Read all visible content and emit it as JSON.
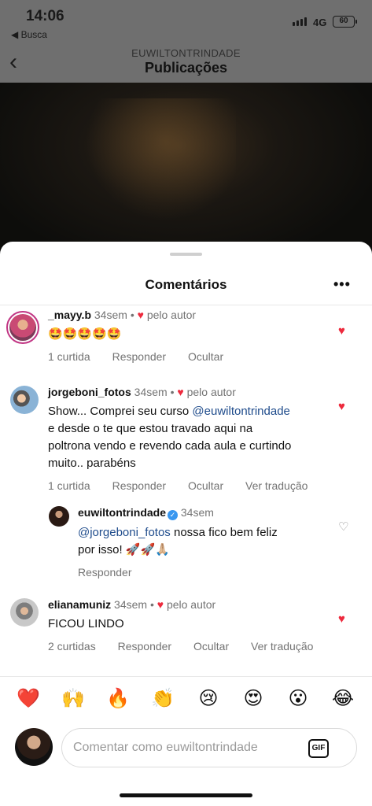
{
  "status": {
    "time": "14:06",
    "back_app": "◀ Busca",
    "network": "4G",
    "battery": "60"
  },
  "nav": {
    "username": "EUWILTONTRINDADE",
    "title": "Publicações",
    "back_glyph": "‹"
  },
  "sheet": {
    "title": "Comentários",
    "more_glyph": "•••"
  },
  "comments": [
    {
      "user": "_mayy.b",
      "time": "34sem",
      "by_author": "pelo autor",
      "text": "🤩🤩🤩🤩🤩",
      "likes": "1 curtida",
      "reply": "Responder",
      "hide": "Ocultar",
      "liked": true
    },
    {
      "user": "jorgeboni_fotos",
      "time": "34sem",
      "by_author": "pelo autor",
      "text_before": "Show... Comprei seu curso ",
      "mention": "@euwiltontrindade",
      "text_line2": "e desde o te que estou travado aqui na",
      "text_line3": "poltrona vendo e revendo cada aula e curtindo",
      "text_line4": "muito.. parabéns",
      "likes": "1 curtida",
      "reply": "Responder",
      "hide": "Ocultar",
      "translate": "Ver tradução",
      "liked": true
    },
    {
      "user": "euwiltontrindade",
      "time": "34sem",
      "mention": "@jorgeboni_fotos",
      "text_after": " nossa fico bem feliz",
      "text_line2": "por isso! 🚀🚀🙏🏼",
      "reply": "Responder",
      "liked": false
    },
    {
      "user": "elianamuniz",
      "time": "34sem",
      "by_author": "pelo autor",
      "text": "FICOU LINDO",
      "likes": "2 curtidas",
      "reply": "Responder",
      "hide": "Ocultar",
      "translate": "Ver tradução",
      "liked": true
    }
  ],
  "reactions": [
    "❤️",
    "🙌",
    "🔥",
    "👏",
    "😢",
    "😍",
    "😮",
    "😂"
  ],
  "composer": {
    "placeholder": "Comentar como euwiltontrindade",
    "gif_label": "GIF"
  },
  "icons": {
    "heart_filled": "♥",
    "heart_outline": "♡",
    "verified": "✓"
  },
  "colors": {
    "like_red": "#ed2a3d",
    "mention_blue": "#1f4c8c",
    "verified_blue": "#3897f0",
    "meta_gray": "#737373"
  }
}
